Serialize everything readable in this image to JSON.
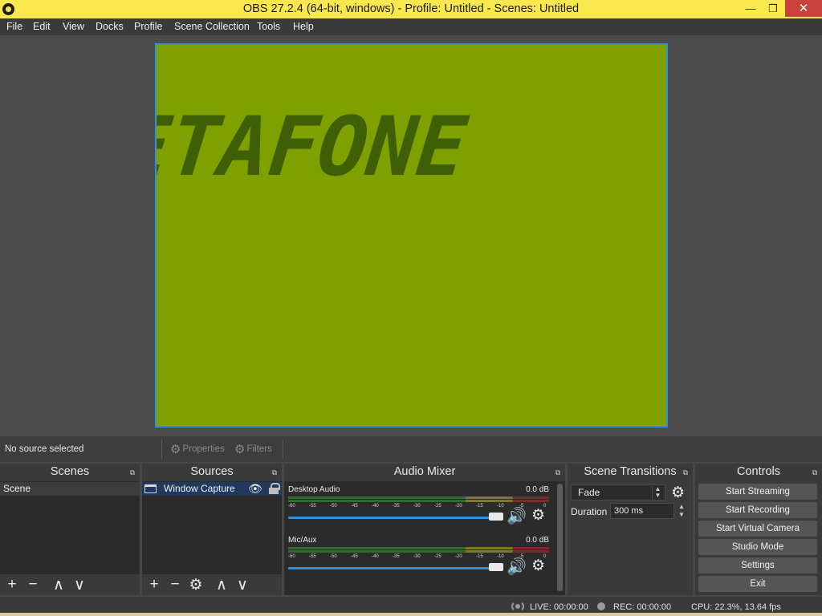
{
  "window": {
    "title": "OBS 27.2.4 (64-bit, windows) - Profile: Untitled - Scenes: Untitled",
    "minimize_glyph": "—",
    "maximize_glyph": "❐",
    "close_glyph": "✕",
    "title_bar_color": "#fae84e"
  },
  "menu": [
    "File",
    "Edit",
    "View",
    "Docks",
    "Profile",
    "Scene Collection",
    "Tools",
    "Help"
  ],
  "preview": {
    "captured_text": "ETAFONE",
    "background_color": "#7fa100",
    "text_color": "#3f5f06",
    "selection_border_color": "#2f8fe0"
  },
  "context_bar": {
    "status": "No source selected",
    "properties_label": "Properties",
    "filters_label": "Filters"
  },
  "docks": {
    "scenes": {
      "title": "Scenes",
      "items": [
        "Scene"
      ],
      "tools": [
        "+",
        "−",
        "∧",
        "∨"
      ]
    },
    "sources": {
      "title": "Sources",
      "items": [
        {
          "name": "Window Capture",
          "visible": true,
          "locked": true
        }
      ],
      "tools": [
        "+",
        "−",
        "⚙",
        "∧",
        "∨"
      ]
    },
    "audio_mixer": {
      "title": "Audio Mixer",
      "scale_ticks": [
        "-60",
        "-55",
        "-50",
        "-45",
        "-40",
        "-35",
        "-30",
        "-25",
        "-20",
        "-15",
        "-10",
        "-5",
        "0"
      ],
      "channels": [
        {
          "name": "Desktop Audio",
          "level": "0.0 dB",
          "volume_fraction": 1.0
        },
        {
          "name": "Mic/Aux",
          "level": "0.0 dB",
          "volume_fraction": 1.0
        }
      ]
    },
    "scene_transitions": {
      "title": "Scene Transitions",
      "selected_transition": "Fade",
      "duration_label": "Duration",
      "duration_value": "300 ms"
    },
    "controls": {
      "title": "Controls",
      "buttons": [
        "Start Streaming",
        "Start Recording",
        "Start Virtual Camera",
        "Studio Mode",
        "Settings",
        "Exit"
      ]
    }
  },
  "status_bar": {
    "live": "LIVE: 00:00:00",
    "rec": "REC: 00:00:00",
    "cpu": "CPU: 22.3%, 13.64 fps"
  },
  "icons": {
    "app": "obs-logo-icon",
    "properties": "gear-icon",
    "filters": "filter-icon",
    "eye": "eye-icon",
    "lock": "lock-icon",
    "speaker": "speaker-icon",
    "settings": "gear-icon"
  },
  "theme": {
    "accent": "#2f8fe0",
    "panel": "#3a3a3a",
    "list_background": "#2b2b2b",
    "button": "#555555"
  }
}
